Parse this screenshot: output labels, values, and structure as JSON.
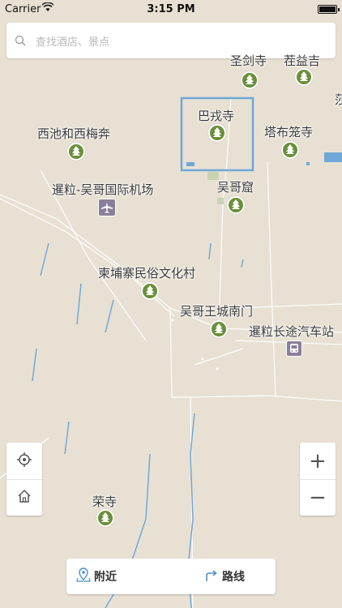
{
  "status_bar": {
    "carrier": "Carrier",
    "time": "3:15 PM"
  },
  "search": {
    "placeholder": "查找酒店、景点"
  },
  "map": {
    "pois": [
      {
        "label": "圣剑寺",
        "icon": "tree-icon"
      },
      {
        "label": "茬益吉",
        "icon": "tree-icon"
      },
      {
        "label": "巴戎寺",
        "icon": "tree-icon"
      },
      {
        "label": "西池和西梅奔",
        "icon": "tree-icon"
      },
      {
        "label": "塔布笼寺",
        "icon": "tree-icon"
      },
      {
        "label": "暹粒-吴哥国际机场",
        "icon": "airport-icon"
      },
      {
        "label": "吴哥窟",
        "icon": "tree-icon"
      },
      {
        "label": "柬埔寨民俗文化村",
        "icon": "tree-icon"
      },
      {
        "label": "吴哥王城南门",
        "icon": "tree-icon"
      },
      {
        "label": "暹粒长途汽车站",
        "icon": "bus-icon"
      },
      {
        "label": "荣寺",
        "icon": "tree-icon"
      }
    ],
    "edge_label": "莎",
    "colors": {
      "land": "#e8e1d3",
      "road": "#ffffff",
      "water": "#6fa8d8",
      "park": "#6a8f3a",
      "highlight": "#6fa8d8"
    }
  },
  "controls": {
    "locate_icon": "locate-icon",
    "home_icon": "home-icon",
    "zoom_in": "+",
    "zoom_out": "−"
  },
  "bottom_bar": {
    "nearby_label": "附近",
    "route_label": "路线"
  }
}
